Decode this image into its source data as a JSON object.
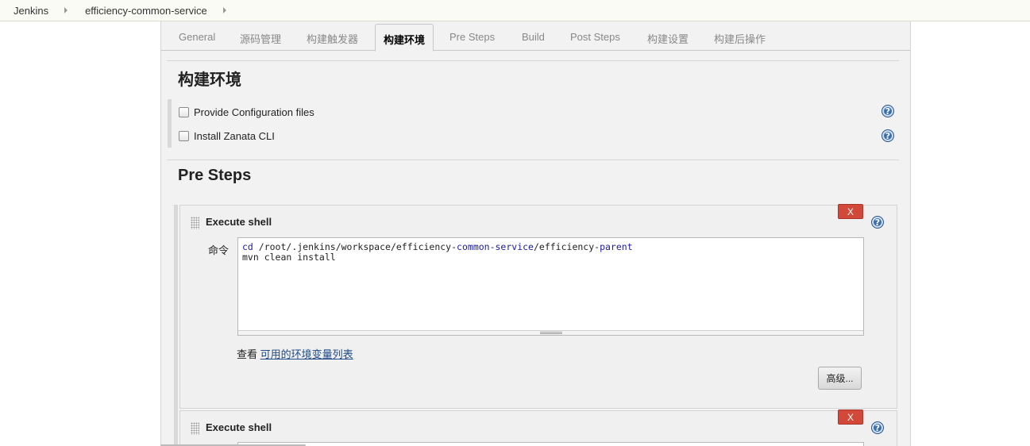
{
  "breadcrumb": {
    "items": [
      "Jenkins",
      "efficiency-common-service"
    ]
  },
  "tabs": [
    "General",
    "源码管理",
    "构建触发器",
    "构建环境",
    "Pre Steps",
    "Build",
    "Post Steps",
    "构建设置",
    "构建后操作"
  ],
  "active_tab": "构建环境",
  "build_env": {
    "title": "构建环境",
    "options": [
      {
        "label": "Provide Configuration files",
        "checked": false
      },
      {
        "label": "Install Zanata CLI",
        "checked": false
      }
    ]
  },
  "pre_steps": {
    "title": "Pre Steps",
    "steps": [
      {
        "title": "Execute shell",
        "delete_label": "X",
        "command_label": "命令",
        "command_lines": {
          "line1_kw": "cd",
          "line1_a": " /root/.jenkins/workspace/efficiency-",
          "line1_b": "common-service",
          "line1_c": "/efficiency-",
          "line1_d": "parent",
          "line2": "mvn clean install"
        },
        "env_prefix": "查看",
        "env_link": "可用的环境变量列表",
        "advanced_label": "高级..."
      },
      {
        "title": "Execute shell",
        "delete_label": "X"
      }
    ]
  },
  "help_icon": "?",
  "colors": {
    "delete_button": "#d24939",
    "help_icon": "#3a6ea8",
    "link": "#204a87",
    "panel_bg": "#f2f2f2"
  }
}
